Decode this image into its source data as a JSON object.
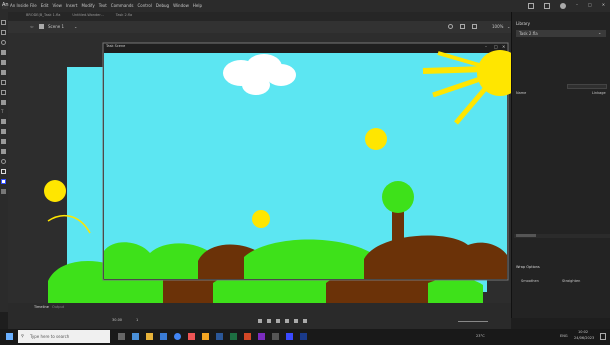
{
  "app": {
    "logo": "An",
    "name": "An Inside"
  },
  "menu": [
    "File",
    "Edit",
    "View",
    "Insert",
    "Modify",
    "Text",
    "Commands",
    "Control",
    "Debug",
    "Window",
    "Help"
  ],
  "doc_tabs": [
    "BRODE(B_Task 1.fla",
    "Untitled-Wonder...",
    "Task 2.fla"
  ],
  "edit_bar": {
    "scene": "Scene 1",
    "zoom": "100%"
  },
  "test_window": {
    "title": "Task Scene"
  },
  "library": {
    "title": "Library",
    "doc": "Task 2.fla",
    "items_label": "Name",
    "linkage_label": "Linkage",
    "wrap_options": "Wrap Options",
    "smoothen": "Smoothen",
    "straighten": "Straighten"
  },
  "timeline": {
    "tabs": [
      "Timeline",
      "Output"
    ],
    "fps": "30.00",
    "frame": "1"
  },
  "taskbar": {
    "search_placeholder": "Type here to search",
    "temp": "23°C",
    "time": "10:02",
    "date": "24/06/2023",
    "lang": "ENG"
  },
  "colors": {
    "sky": "#5ce6f2",
    "grass": "#3ee11a",
    "dirt": "#6b3208",
    "sun": "#ffe600",
    "cloud": "#ffffff"
  }
}
